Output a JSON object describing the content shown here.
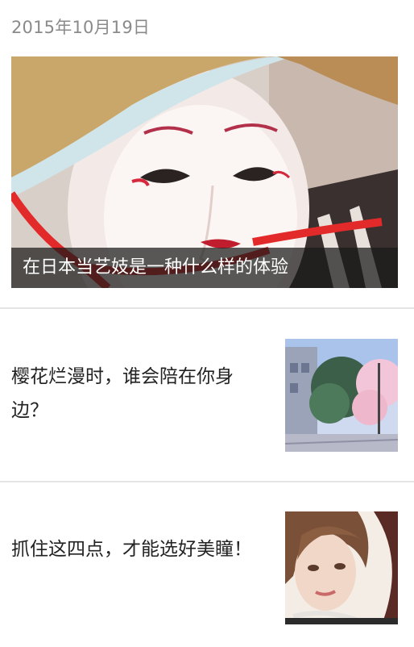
{
  "feed": {
    "date": "2015年10月19日",
    "hero": {
      "caption": "在日本当艺妓是一种什么样的体验",
      "image_icon": "geisha-photo"
    },
    "articles": [
      {
        "title": "樱花烂漫时，谁会陪在你身边？",
        "thumb_icon": "cherry-blossom-street-photo"
      },
      {
        "title": "抓住这四点，才能选好美瞳！",
        "thumb_icon": "woman-portrait-photo"
      }
    ]
  }
}
